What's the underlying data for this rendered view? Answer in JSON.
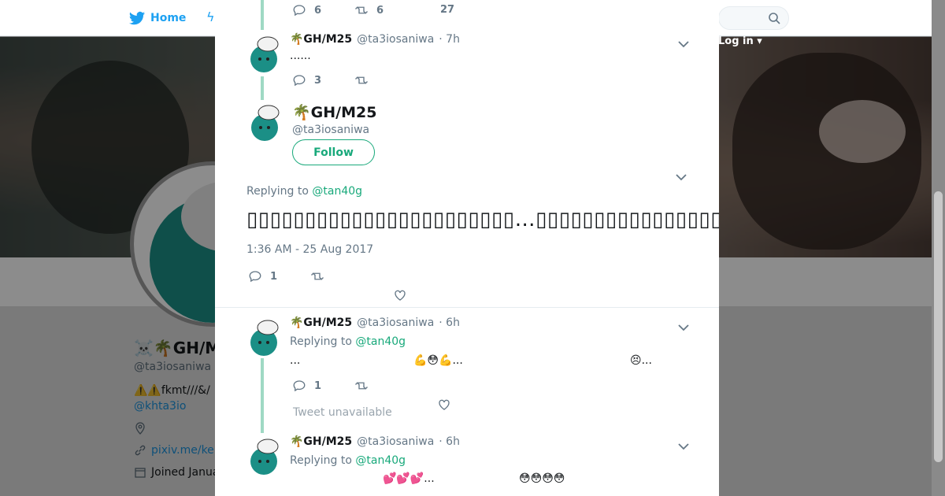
{
  "background": {
    "nav": {
      "home_label": "Home",
      "login_label": "Log in"
    },
    "profile": {
      "name": "☠️🌴GH/M",
      "handle": "@ta3iosaniwa",
      "bio": "⚠️⚠️fkmt///&/",
      "mention": "@khta3io",
      "link": "pixiv.me/ke",
      "joined": "Joined Janua"
    }
  },
  "tweets_above": [
    {
      "reply_count": "6",
      "retweet_count": "6",
      "like_count": "27"
    },
    {
      "name": "🌴GH/M25",
      "handle": "@ta3iosaniwa",
      "time": "· 7h",
      "text": "......",
      "reply_count": "3"
    }
  ],
  "focus_tweet": {
    "name": "🌴GH/M25",
    "handle": "@ta3iosaniwa",
    "follow_label": "Follow",
    "replying_prefix": "Replying to",
    "replying_to": "@tan40g",
    "text": "▯▯▯▯▯▯▯▯▯▯▯▯▯▯▯▯▯▯▯▯▯▯▯…▯▯▯▯▯▯▯▯▯▯▯▯▯▯▯▯▯▯▯▯▯▯💪😣▯▯ ▯▯▯▯▯ . 👮",
    "timestamp": "1:36 AM - 25 Aug 2017",
    "reply_count": "1"
  },
  "replies": [
    {
      "name": "🌴GH/M25",
      "handle": "@ta3iosaniwa",
      "time": "· 6h",
      "replying_prefix": "Replying to",
      "replying_to": "@tan40g",
      "text_a": "...",
      "text_b": "💪😳💪...",
      "text_c": "😣...",
      "reply_count": "1",
      "unavailable": "Tweet unavailable"
    },
    {
      "name": "🌴GH/M25",
      "handle": "@ta3iosaniwa",
      "time": "· 6h",
      "replying_prefix": "Replying to",
      "replying_to": "@tan40g",
      "text_a": "💕💕💕...",
      "text_b": "😳😳😳😳"
    }
  ],
  "icons": {
    "close": "close-icon",
    "reply": "reply-icon",
    "retweet": "retweet-icon",
    "like": "heart-icon",
    "caret": "chevron-down-icon"
  },
  "colors": {
    "accent": "#19a97b",
    "thread_line": "#9fd9c4",
    "twitter_blue": "#1da1f2"
  }
}
